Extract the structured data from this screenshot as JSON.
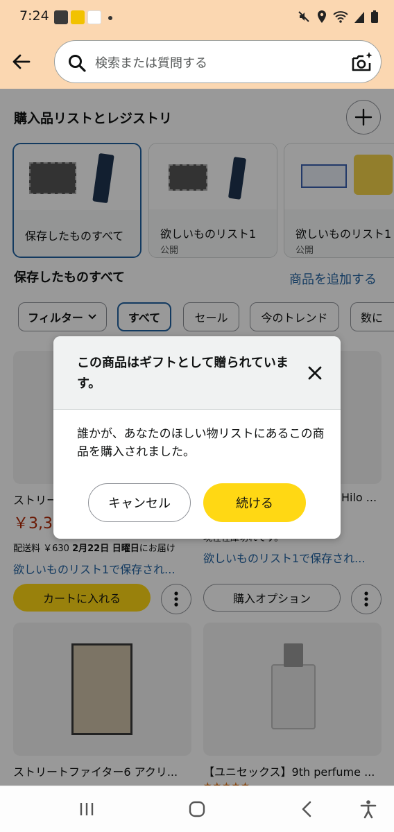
{
  "status_bar": {
    "time": "7:24"
  },
  "search": {
    "placeholder": "検索または質問する"
  },
  "lists_section": {
    "title": "購入品リストとレジストリ",
    "cards": [
      {
        "label": "保存したものすべて",
        "sub": ""
      },
      {
        "label": "欲しいものリスト1",
        "sub": "公開"
      },
      {
        "label": "欲しいものリスト1",
        "sub": "公開"
      }
    ]
  },
  "items_section": {
    "title": "保存したものすべて",
    "add_link": "商品を追加する"
  },
  "filters": {
    "filter_label": "フィルター",
    "chips": [
      "すべて",
      "セール",
      "今のトレンド",
      "数に"
    ]
  },
  "products": [
    {
      "title": "ストリートファイター",
      "price": "￥3,36",
      "delivery_prefix": "配送料 ￥630 ",
      "delivery_date": "2月22日 日曜日",
      "delivery_suffix": "にお届け",
      "saved": "欲しいものリスト1で保存され..."
    },
    {
      "title": "Hilo ...",
      "stock": "現在在庫切れです。",
      "saved": "欲しいものリスト1で保存され..."
    },
    {
      "title": "ストリートファイター6 アクリ..."
    },
    {
      "title": "【ユニセックス】9th perfume ..."
    }
  ],
  "buttons": {
    "add_to_cart": "カートに入れる",
    "purchase_options": "購入オプション"
  },
  "modal": {
    "title": "この商品はギフトとして贈られています。",
    "body": "誰かが、あなたのほしい物リストにあるこの商品を購入されました。",
    "cancel": "キャンセル",
    "continue": "続ける"
  },
  "colors": {
    "accent_link": "#2162a1",
    "primary_button": "#ffd814",
    "price_red": "#b12704",
    "header_bg": "#fbd7b1"
  }
}
